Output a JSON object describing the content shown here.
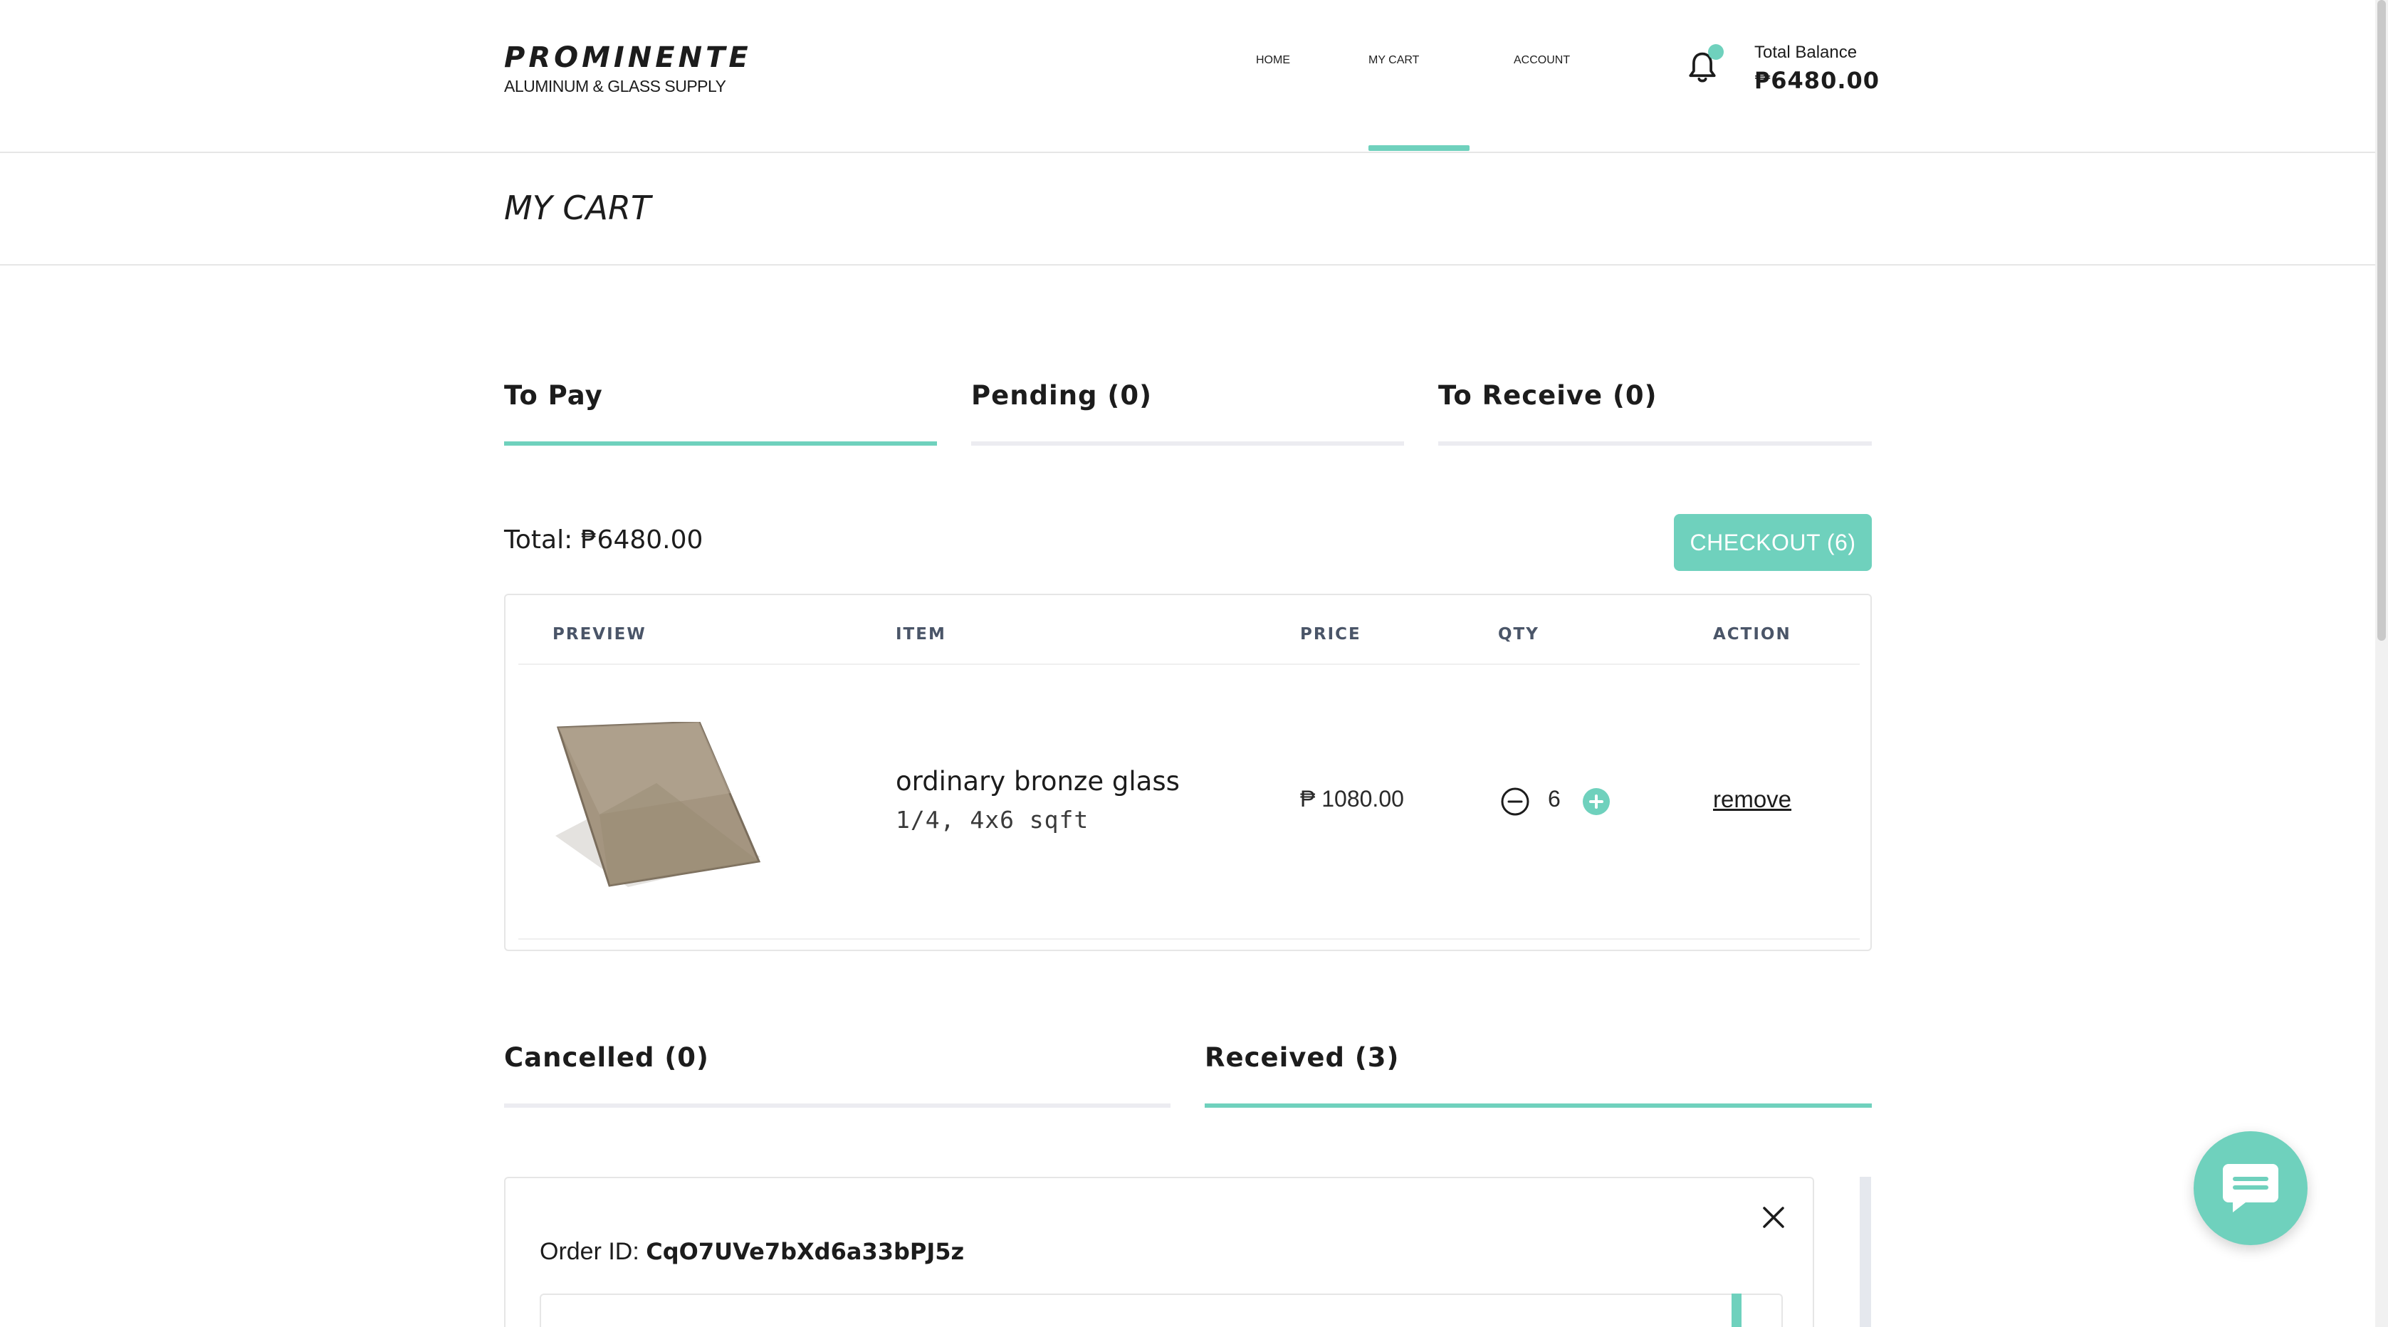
{
  "brand": {
    "name": "PROMINENTE",
    "subtitle": "ALUMINUM & GLASS SUPPLY"
  },
  "nav": {
    "items": [
      {
        "label": "HOME"
      },
      {
        "label": "MY CART",
        "active": true
      },
      {
        "label": "ACCOUNT"
      }
    ]
  },
  "balance": {
    "label": "Total Balance",
    "value": "₱6480.00"
  },
  "page": {
    "title": "MY CART"
  },
  "tabs_top": [
    {
      "label": "To Pay",
      "active": true
    },
    {
      "label": "Pending (0)",
      "active": false
    },
    {
      "label": "To Receive (0)",
      "active": false
    }
  ],
  "cart": {
    "total_label": "Total: ₱6480.00",
    "checkout_label": "CHECKOUT (6)",
    "columns": [
      "PREVIEW",
      "ITEM",
      "PRICE",
      "QTY",
      "ACTION"
    ],
    "rows": [
      {
        "item_name": "ordinary bronze glass",
        "item_spec": "1/4, 4x6 sqft",
        "price": "₱ 1080.00",
        "qty": "6",
        "action": "remove"
      }
    ]
  },
  "tabs_bottom": [
    {
      "label": "Cancelled (0)",
      "active": false
    },
    {
      "label": "Received (3)",
      "active": true
    }
  ],
  "order": {
    "label": "Order ID:",
    "id": "CqO7UVe7bXd6a33bPJ5z"
  },
  "colors": {
    "accent": "#6fd1bd",
    "text": "#1c1c1c",
    "border": "#e6e6e6",
    "glass": "#a49580"
  },
  "icons": {
    "bell": "bell-icon",
    "minus": "minus-circle-icon",
    "plus": "plus-circle-icon",
    "close": "close-icon",
    "chat": "chat-icon"
  }
}
